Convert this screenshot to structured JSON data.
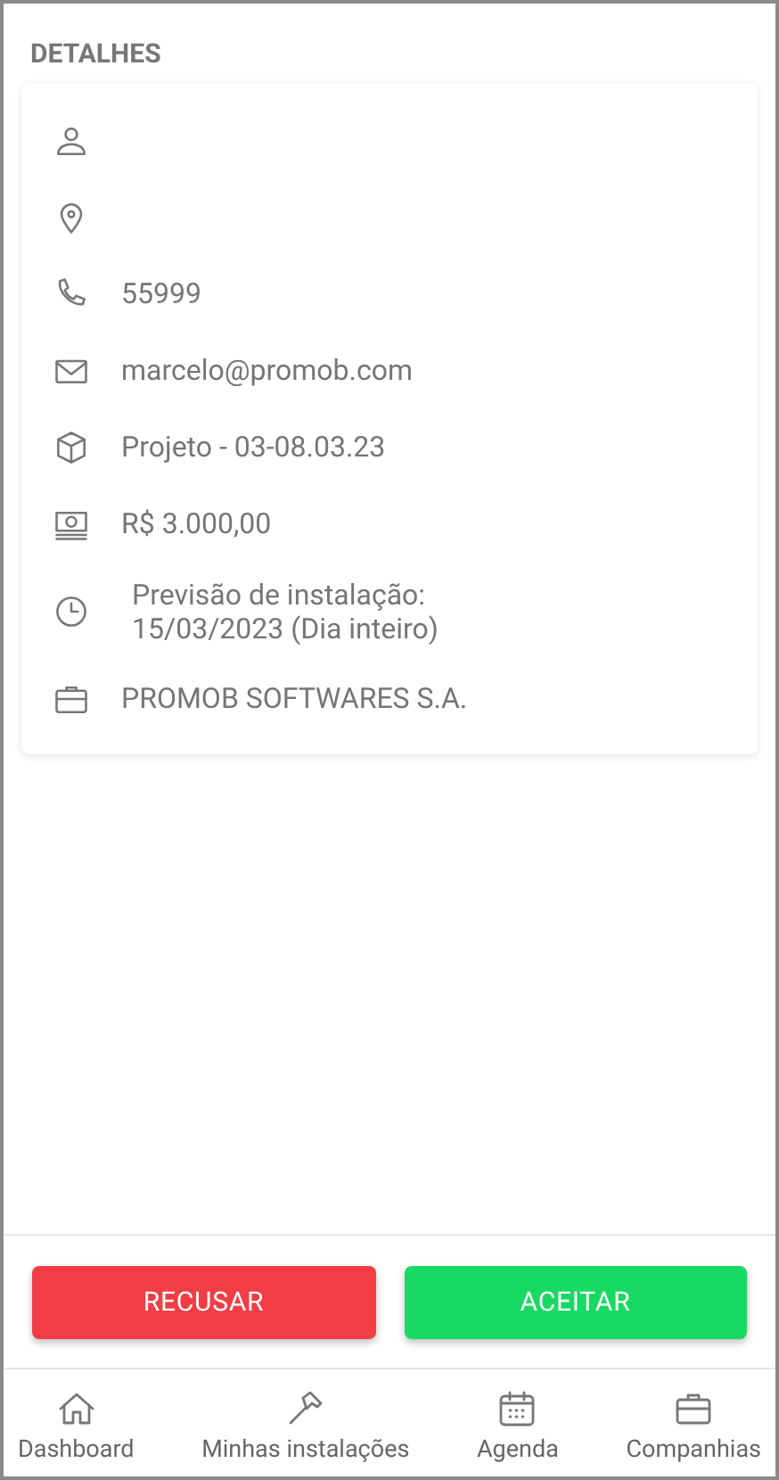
{
  "section_title": "DETALHES",
  "details": [
    {
      "kind": "person"
    },
    {
      "kind": "location"
    },
    {
      "kind": "phone",
      "text": "55999"
    },
    {
      "kind": "email",
      "text": "marcelo@promob.com"
    },
    {
      "kind": "project",
      "text": "Projeto - 03-08.03.23"
    },
    {
      "kind": "money",
      "text": "R$ 3.000,00"
    },
    {
      "kind": "clock",
      "text": "Previsão de instalação:\n15/03/2023 (Dia inteiro)"
    },
    {
      "kind": "company",
      "text": "PROMOB SOFTWARES S.A."
    }
  ],
  "actions": [
    {
      "kind": "reject",
      "label": "RECUSAR"
    },
    {
      "kind": "accept",
      "label": "ACEITAR"
    }
  ],
  "bottom_nav": [
    {
      "kind": "home",
      "label": "Dashboard"
    },
    {
      "kind": "hammer",
      "label": "Minhas instalações"
    },
    {
      "kind": "calendar",
      "label": "Agenda"
    },
    {
      "kind": "briefcase",
      "label": "Companhias"
    }
  ]
}
